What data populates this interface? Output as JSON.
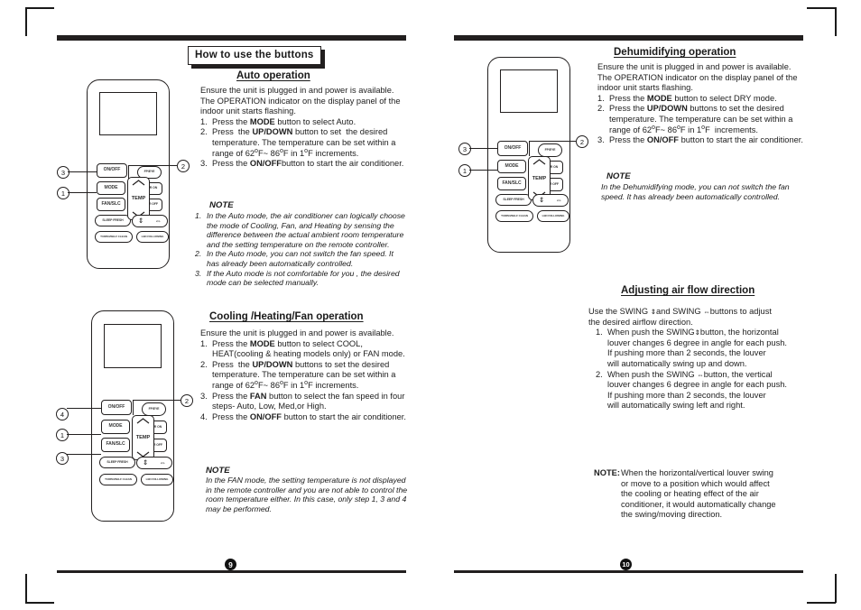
{
  "document": {
    "header_box": "How to use the buttons",
    "page_left_number": "9",
    "page_right_number": "10"
  },
  "left_page": {
    "auto": {
      "title": "Auto operation",
      "intro": "Ensure the unit is plugged in and power is available. The OPERATION indicator on the display panel of the indoor unit starts flashing.",
      "steps": [
        {
          "num": "1.",
          "text": "Press the MODE button to select Auto.",
          "bold": "MODE"
        },
        {
          "num": "2.",
          "text": "Press  the UP/DOWN button to set  the desired temperature. The temperature can be set within a range of 62°F~ 86°F in 1°F increments.",
          "bold": "UP/DOWN"
        },
        {
          "num": "3.",
          "text": "Press the ON/OFFbutton to start the air conditioner.",
          "bold": "ON/OFF"
        }
      ],
      "note_label": "NOTE",
      "notes": [
        {
          "num": "1.",
          "text": "In the Auto mode, the air  conditioner  can  logically choose the mode of Cooling, Fan, and Heating by sensing the difference between the actual ambient room temperature and the setting temperature on the remote controller."
        },
        {
          "num": "2.",
          "text": "In the Auto mode, you can not switch the fan speed. It has already been automatically controlled."
        },
        {
          "num": "3.",
          "text": "If the Auto mode is not comfortable for you , the desired mode can be selected manually."
        }
      ]
    },
    "cooling": {
      "title": "Cooling /Heating/Fan operation",
      "intro": "Ensure the unit is plugged in and power is available.",
      "steps": [
        {
          "num": "1.",
          "text": "Press the MODE button to select COOL, HEAT(cooling & heating models only) or FAN mode.",
          "bold": "MODE"
        },
        {
          "num": "2.",
          "text": "Press  the UP/DOWN buttons to set the desired temperature. The temperature can be set within a range of 62°F~ 86°F in 1°F increments.",
          "bold": "UP/DOWN"
        },
        {
          "num": "3.",
          "text": "Press the FAN button to select the fan speed in four steps- Auto, Low, Med,or High.",
          "bold": "FAN"
        },
        {
          "num": "4.",
          "text": "Press the ON/OFF button to start the air conditioner.",
          "bold": "ON/OFF"
        }
      ],
      "note_label": "NOTE",
      "note_text": "In the FAN mode, the setting temperature is not displayed in the remote controller and you are not able to control the room temperature either. In this case, only step 1, 3 and 4 may be performed."
    }
  },
  "right_page": {
    "dehumidifying": {
      "title": "Dehumidifying  operation",
      "intro": "Ensure the unit is plugged in and power is available. The OPERATION indicator on the display panel of the indoor unit starts flashing.",
      "steps": [
        {
          "num": "1.",
          "text": "Press the MODE button to select DRY mode.",
          "bold": "MODE"
        },
        {
          "num": "2.",
          "text": "Press the UP/DOWN buttons to set the desired temperature. The temperature can be set within a range of 62°F~ 86°F in 1°F  increments.",
          "bold": "UP/DOWN"
        },
        {
          "num": "3.",
          "text": "Press the ON/OFF button to start the air conditioner.",
          "bold": "ON/OFF"
        }
      ],
      "note_label": "NOTE",
      "note_text": "In the Dehumidifying  mode, you can not switch  the fan speed. It has already been automatically controlled."
    },
    "airflow": {
      "title": "Adjusting air flow direction",
      "intro_a": "Use the SWING ",
      "intro_b": "and SWING ",
      "intro_c": "buttons to adjust",
      "intro_line2": "the desired airflow direction.",
      "steps": [
        {
          "num": "1.",
          "pre": "When push the SWING",
          "post": "button, the horizontal",
          "lines": [
            "louver changes 6 degree in angle for each push.",
            "If pushing more than 2 seconds, the louver",
            "will automatically swing up and down."
          ],
          "glyph": "vertical-swing"
        },
        {
          "num": "2.",
          "pre": "When push the SWING ",
          "post": "button, the vertical",
          "lines": [
            "louver changes 6 degree in angle for each push.",
            "If pushing more than 2 seconds, the louver",
            "will automatically swing left and right."
          ],
          "glyph": "horizontal-swing"
        }
      ],
      "note_label": "NOTE:",
      "note_lines": [
        "When the horizontal/vertical louver swing",
        "or move to a position which would affect",
        "the cooling or heating effect of the air",
        "conditioner, it would automatically change",
        "the swing/moving direction."
      ]
    }
  },
  "remotes": {
    "buttons": {
      "onoff": "ON/OFF",
      "mode": "MODE",
      "fanslc": "FAN/SLC",
      "sleep_fresh": "SLEEP FRESH",
      "turbo_self_clean": "TURBO/SELF CLEAN",
      "fpeye": "FP/EYE",
      "timer_on": "TIMER ON",
      "timer_off": "TIMER OFF",
      "led_following": "LED FOLLOWING",
      "temp": "TEMP",
      "swing_vertical": "⇕",
      "swing_horizontal": "⇔"
    },
    "remote1": {
      "callouts": {
        "onoff": "3",
        "mode": "1",
        "temp": "2"
      }
    },
    "remote2": {
      "callouts": {
        "onoff": "4",
        "mode": "1",
        "fanslc": "3",
        "temp": "2"
      }
    },
    "remote3": {
      "callouts": {
        "onoff": "3",
        "mode": "1",
        "temp": "2"
      }
    }
  },
  "colors": {
    "ink": "#221f1f",
    "paper": "#ffffff"
  }
}
